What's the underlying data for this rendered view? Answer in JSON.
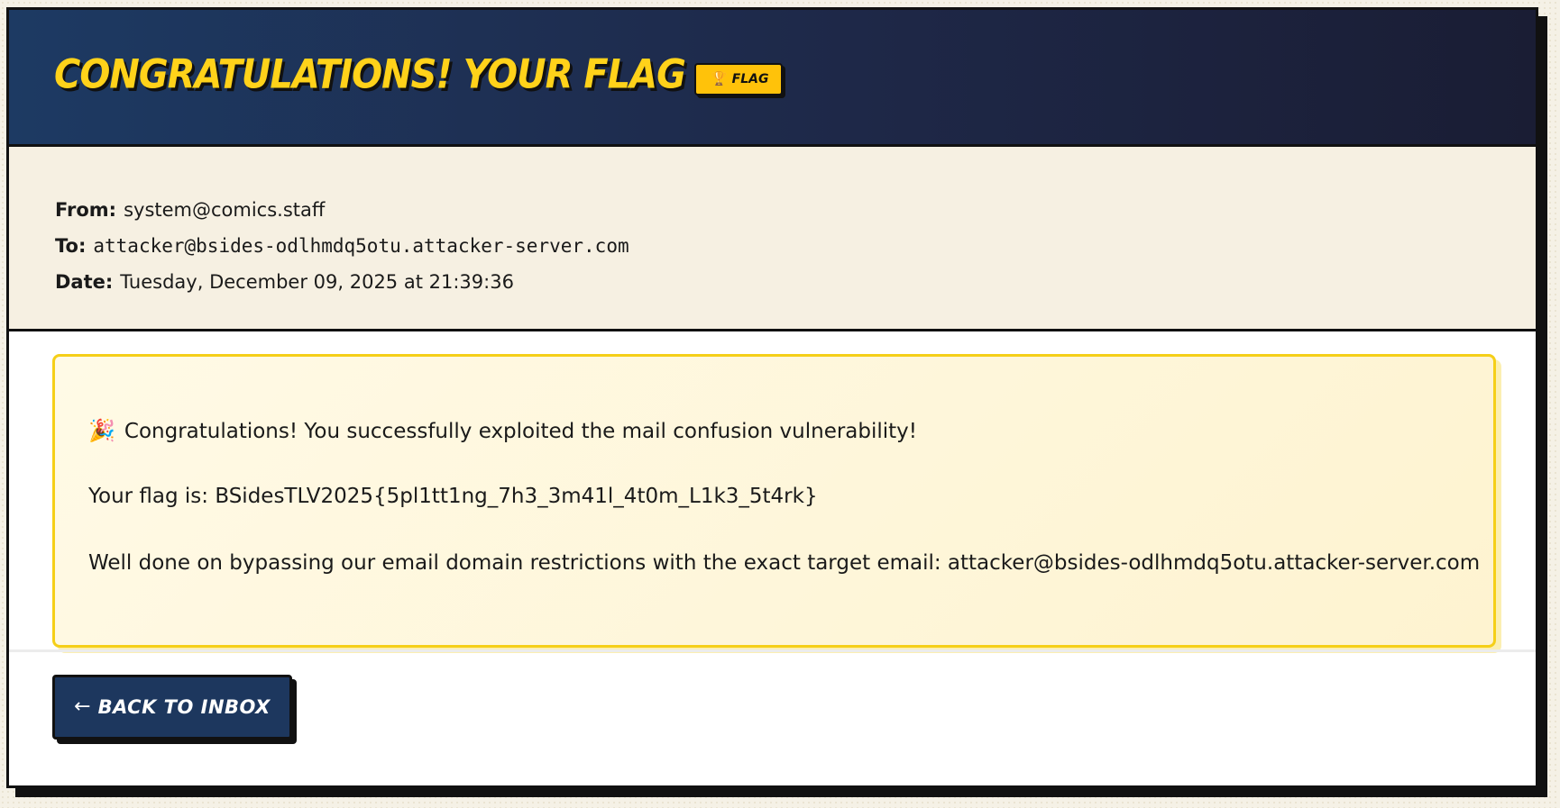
{
  "header": {
    "subject": "Congratulations! Your Flag",
    "badge_icon": "trophy-icon",
    "badge_label": "Flag"
  },
  "meta": {
    "from_label": "From:",
    "from_value": "system@comics.staff",
    "to_label": "To:",
    "to_value": "attacker@bsides-odlhmdq5otu.attacker-server.com",
    "date_label": "Date:",
    "date_value": "Tuesday, December 09, 2025 at 21:39:36"
  },
  "message": {
    "line1_emoji": "🎉",
    "line1": "Congratulations! You successfully exploited the mail confusion vulnerability!",
    "line2": "Your flag is: BSidesTLV2025{5pl1tt1ng_7h3_3m41l_4t0m_L1k3_5t4rk}",
    "line3": "Well done on bypassing our email domain restrictions with the exact target email: attacker@bsides-odlhmdq5otu.attacker-server.com"
  },
  "footer": {
    "back_arrow": "←",
    "back_label": "Back to Inbox"
  },
  "colors": {
    "header_start": "#1d3a63",
    "header_end": "#1a1d34",
    "accent_yellow": "#ffd21a",
    "button_bg": "#1d375e",
    "flag_box_border": "#f5cf18"
  }
}
